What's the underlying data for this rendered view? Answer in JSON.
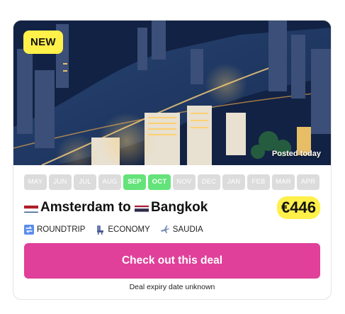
{
  "card": {
    "badge": "NEW",
    "posted": "Posted today",
    "months": [
      {
        "label": "MAY",
        "active": false
      },
      {
        "label": "JUN",
        "active": false
      },
      {
        "label": "JUL",
        "active": false
      },
      {
        "label": "AUG",
        "active": false
      },
      {
        "label": "SEP",
        "active": true
      },
      {
        "label": "OCT",
        "active": true
      },
      {
        "label": "NOV",
        "active": false
      },
      {
        "label": "DEC",
        "active": false
      },
      {
        "label": "JAN",
        "active": false
      },
      {
        "label": "FEB",
        "active": false
      },
      {
        "label": "MAR",
        "active": false
      },
      {
        "label": "APR",
        "active": false
      }
    ],
    "origin": "Amsterdam",
    "connector": " to ",
    "destination": "Bangkok",
    "price": "€446",
    "trip_type": "ROUNDTRIP",
    "cabin": "ECONOMY",
    "airline": "SAUDIA",
    "cta_label": "Check out this deal",
    "expiry": "Deal expiry date unknown"
  },
  "colors": {
    "accent_pink": "#e0409a",
    "highlight_yellow": "#fff04a",
    "active_month_green": "#63e37a",
    "inactive_month_gray": "#dcdcdc"
  },
  "icons": {
    "origin_flag": "netherlands-flag-icon",
    "destination_flag": "thailand-flag-icon",
    "trip_type": "roundtrip-icon",
    "cabin": "seat-icon",
    "airline": "airplane-icon"
  }
}
